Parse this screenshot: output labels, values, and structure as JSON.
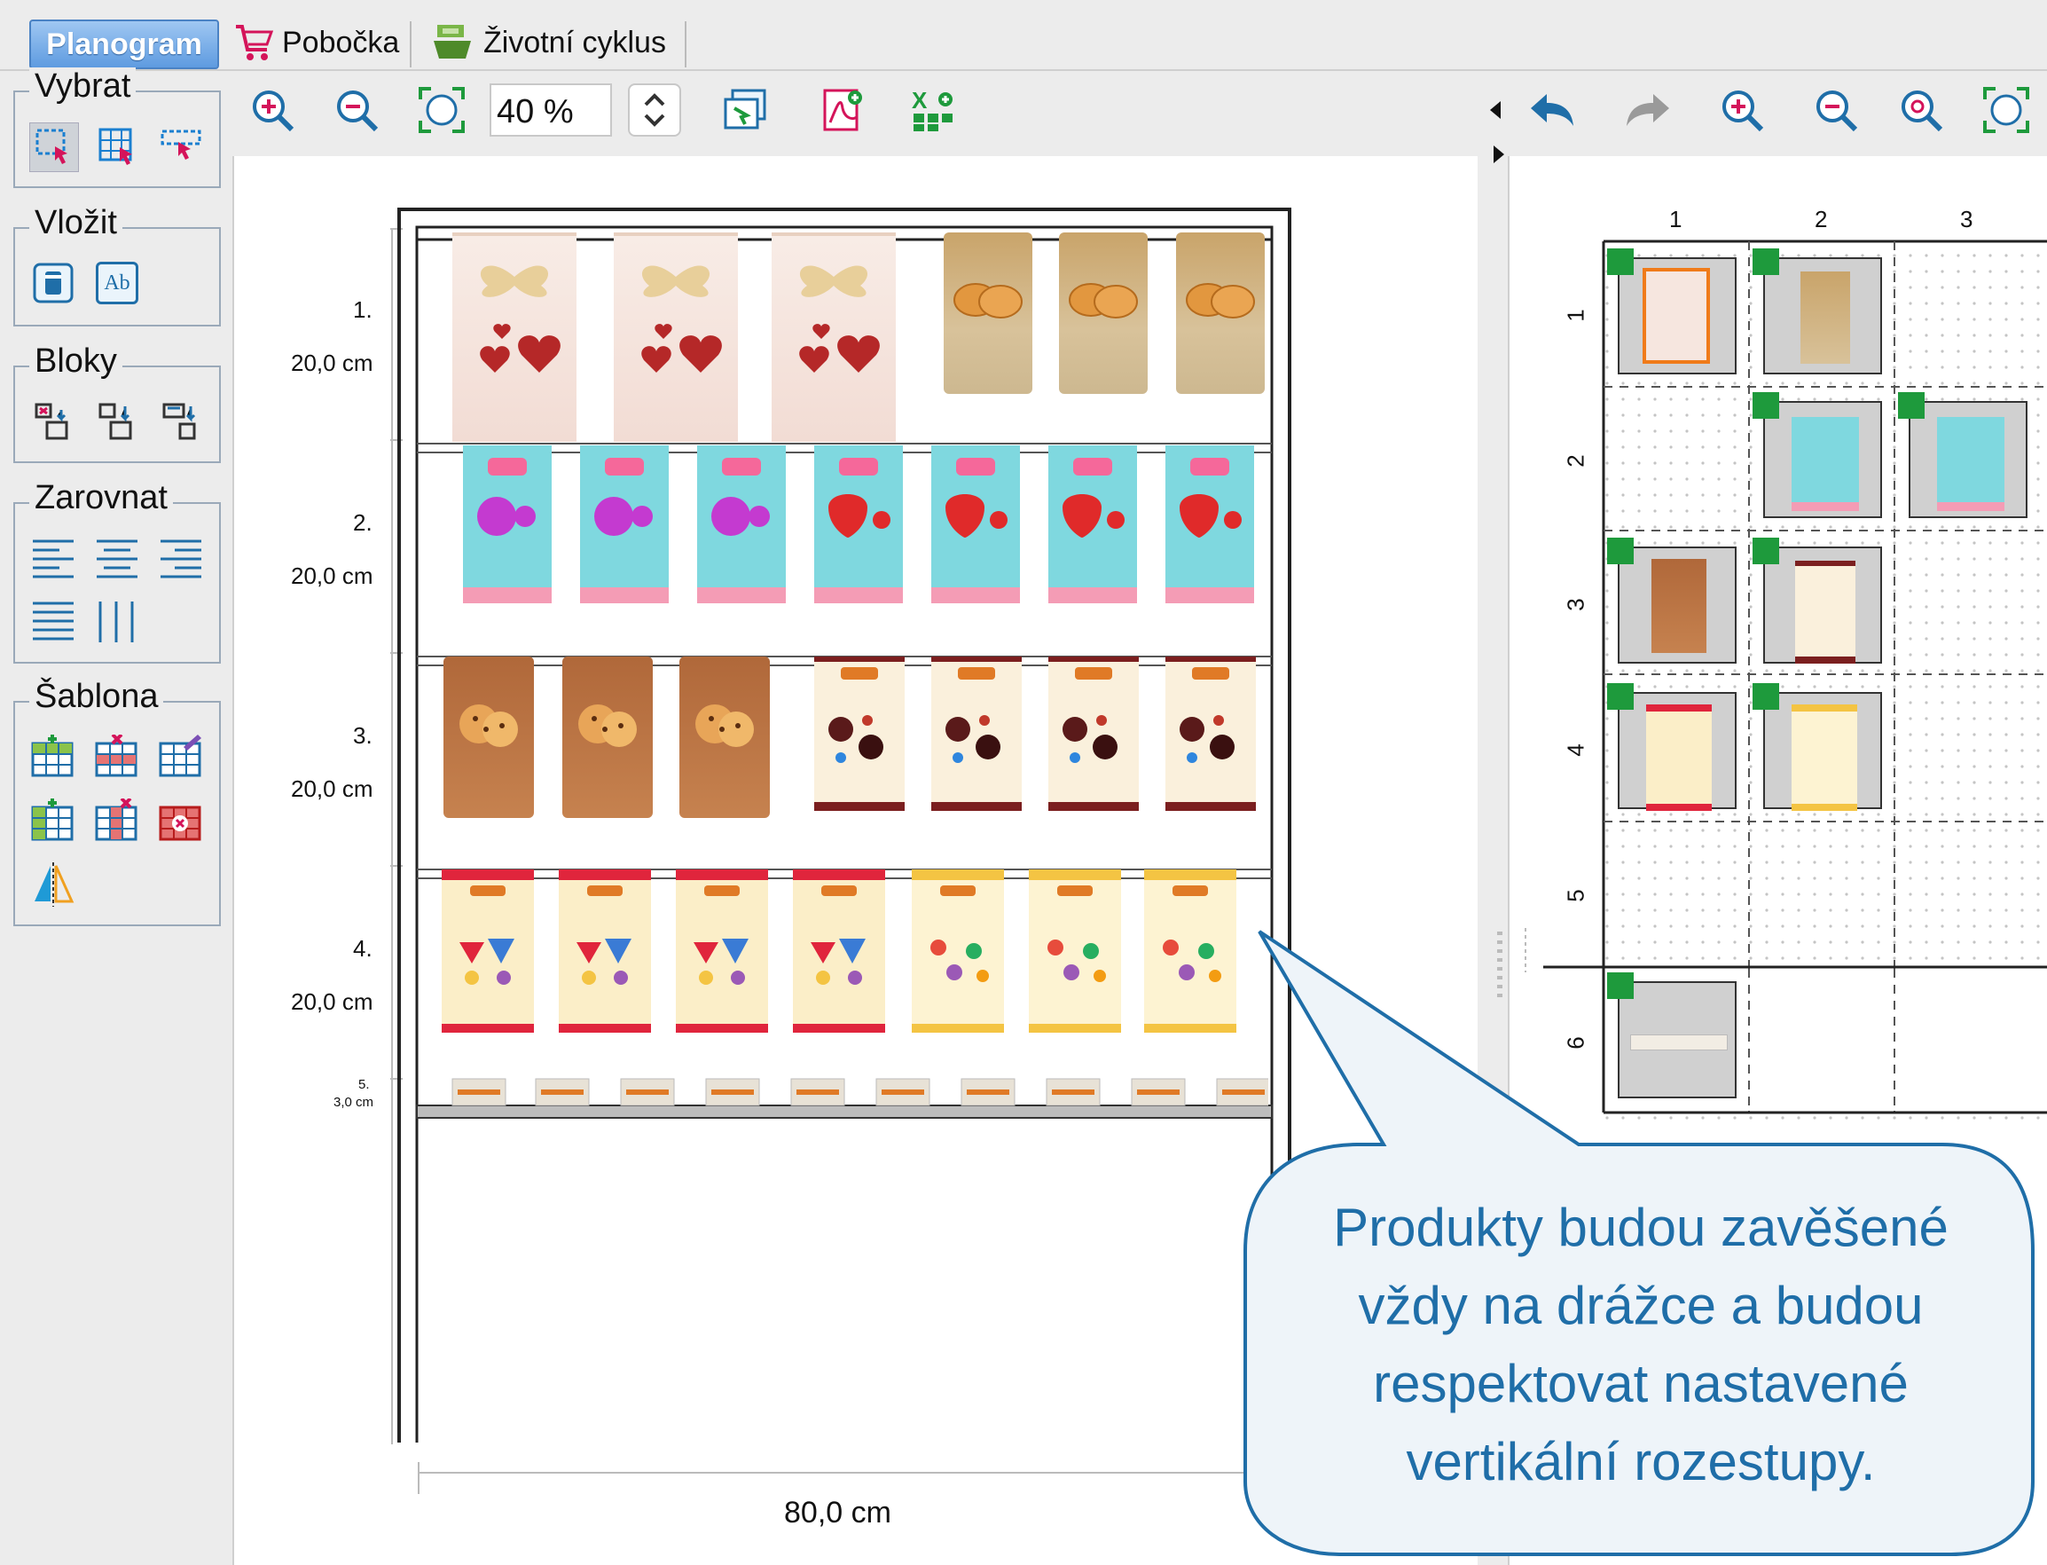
{
  "tabs": [
    {
      "label": "Planogram",
      "active": true
    },
    {
      "label": "Pobočka",
      "icon": "cart-icon"
    },
    {
      "label": "Životní cyklus",
      "icon": "lifecycle-icon"
    }
  ],
  "palette": {
    "select_title": "Vybrat",
    "insert_title": "Vložit",
    "blocks_title": "Bloky",
    "align_title": "Zarovnat",
    "template_title": "Šablona",
    "insert_text_glyph": "Ab"
  },
  "toolbar": {
    "zoom_value": "40 %"
  },
  "planogram": {
    "shelves": [
      {
        "index": "1.",
        "height": "20,0 cm"
      },
      {
        "index": "2.",
        "height": "20,0 cm"
      },
      {
        "index": "3.",
        "height": "20,0 cm"
      },
      {
        "index": "4.",
        "height": "20,0 cm"
      },
      {
        "index": "5.",
        "height": "3,0 cm"
      }
    ],
    "width": "80,0 cm"
  },
  "grid": {
    "columns": [
      "1",
      "2",
      "3"
    ],
    "rows": [
      "1",
      "2",
      "3",
      "4",
      "5",
      "6"
    ]
  },
  "callout": {
    "lines": [
      "Produkty budou zavěšené",
      "vždy na drážce a budou",
      "respektovat nastavené",
      "vertikální rozestupy."
    ]
  },
  "colors": {
    "accent": "#1f6ea8",
    "callout_bg": "#eef4f9",
    "grid_marker": "#1e9a3c",
    "candy_blue": "#7fd8df",
    "cookie_brown": "#b0683a",
    "choco_cream": "#faf0dc",
    "bonbon_red": "#e0253c",
    "fruit_yellow": "#f4c443"
  }
}
